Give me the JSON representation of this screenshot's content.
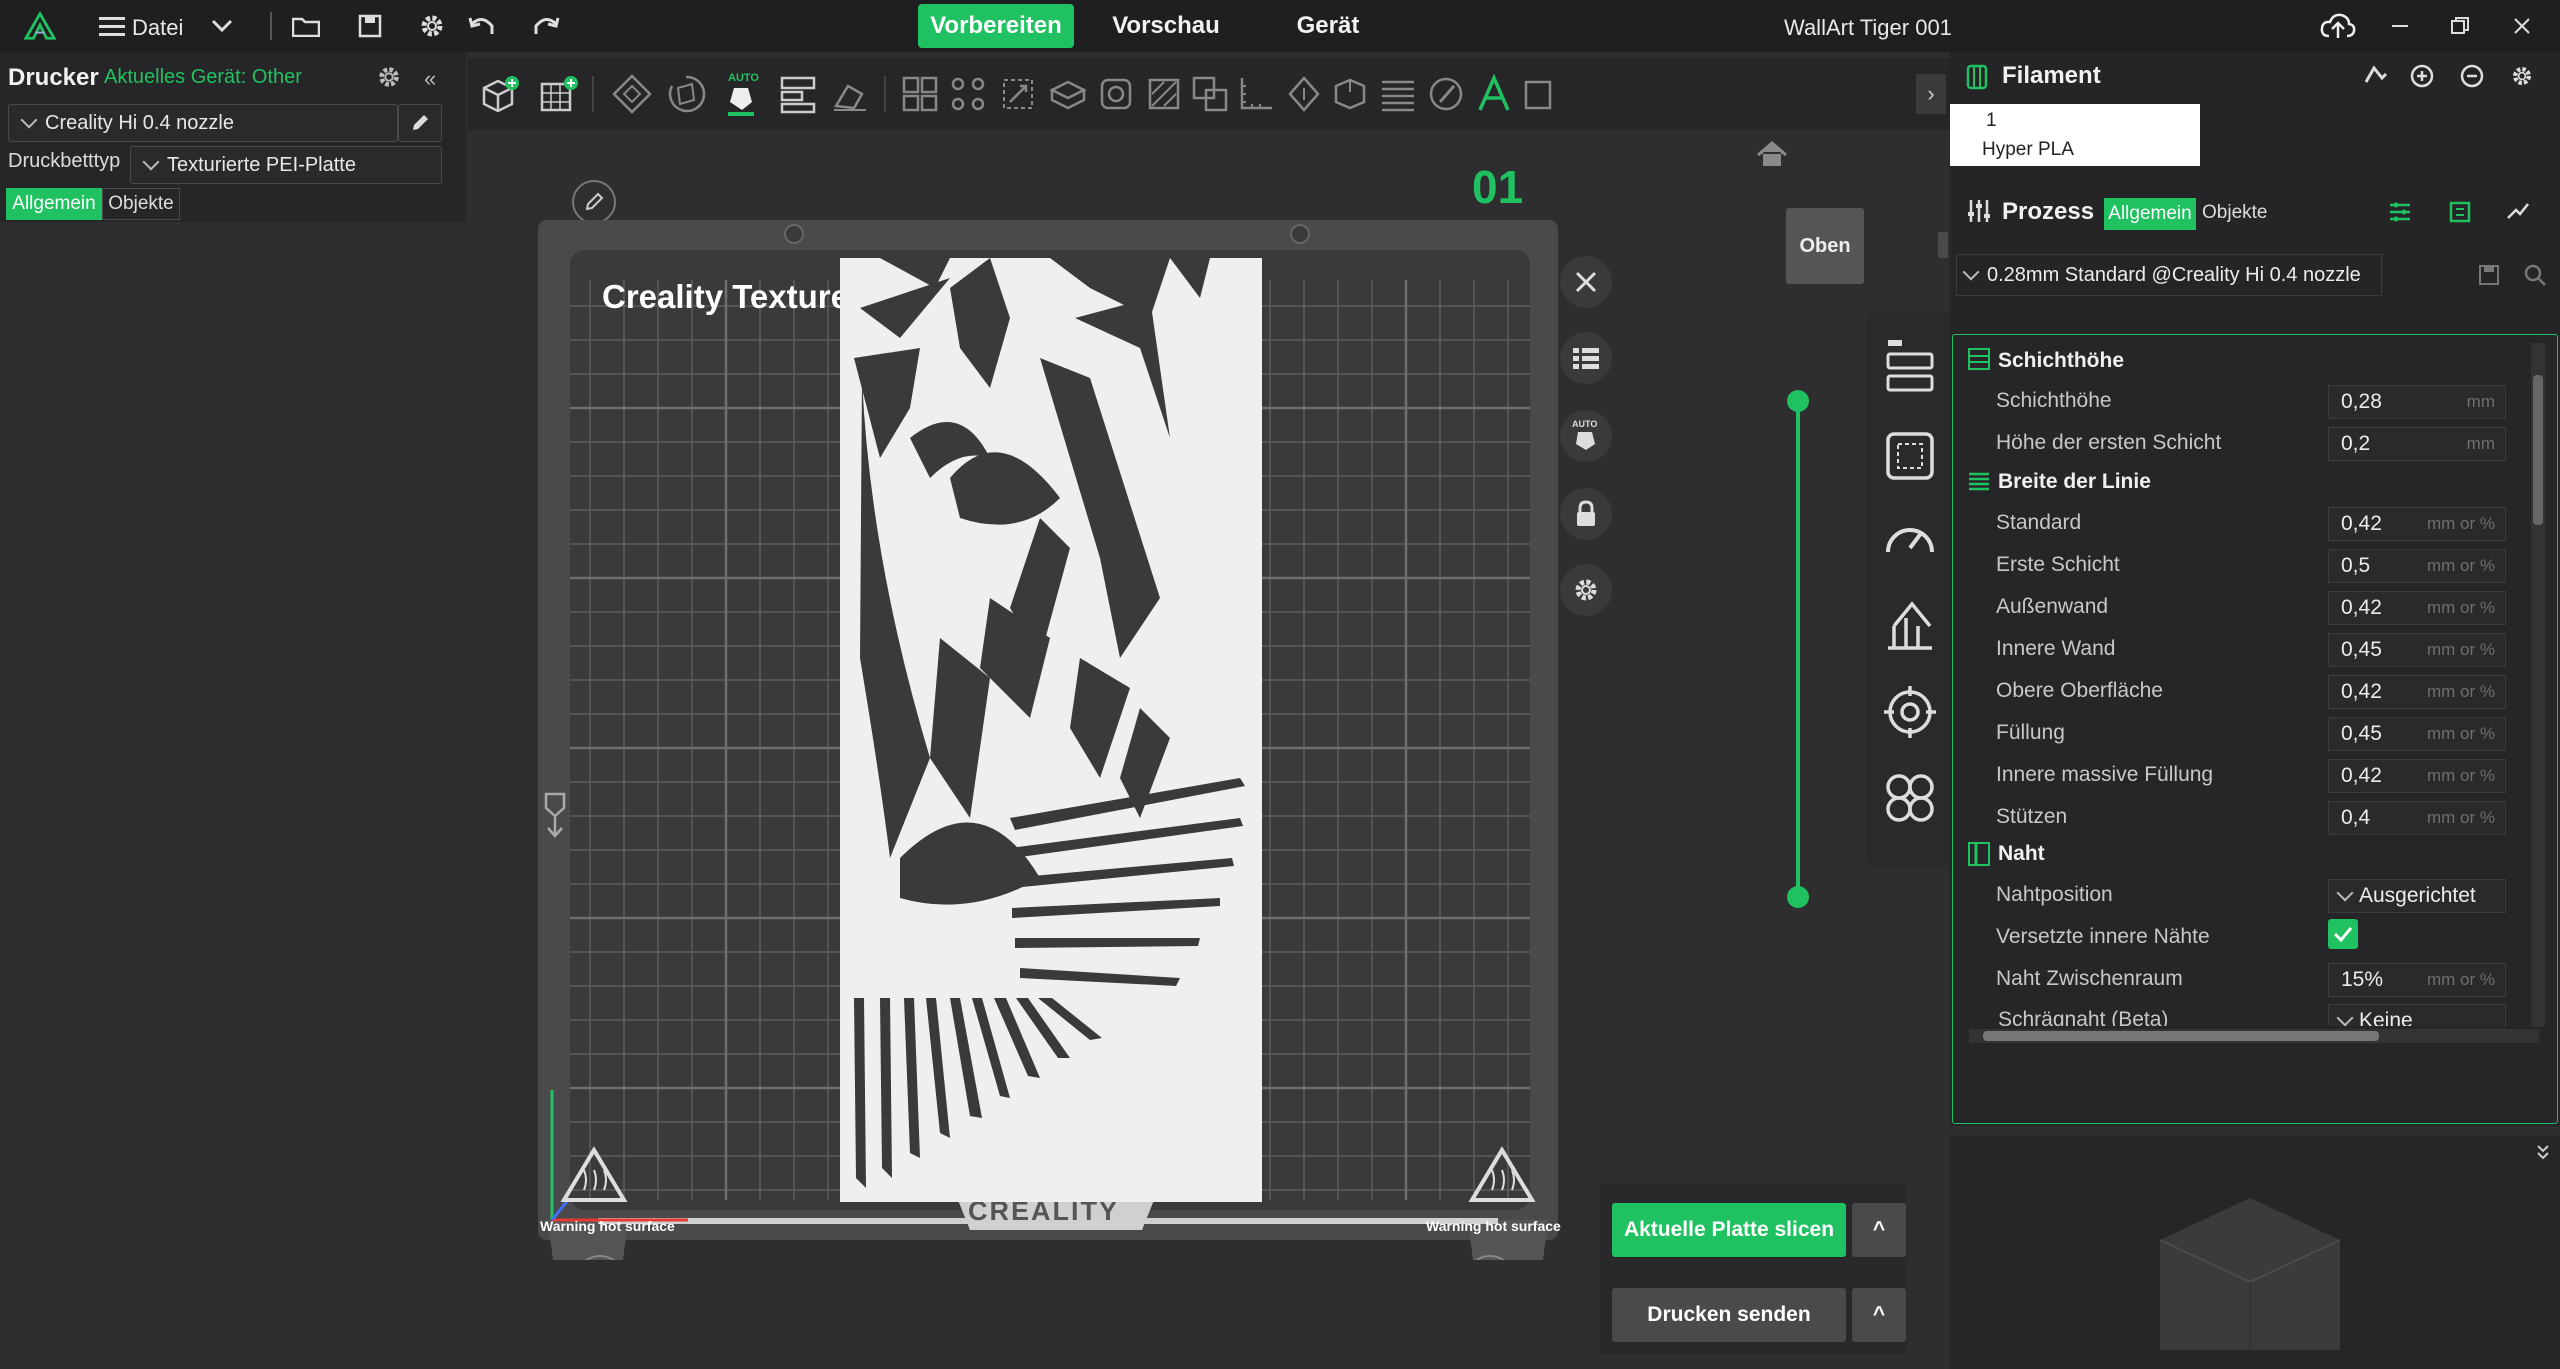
{
  "app": {
    "logo": "creality-logo",
    "menu_label": "Datei",
    "window_title": "WallArt Tiger 001"
  },
  "tabs": [
    {
      "label": "Vorbereiten",
      "active": true
    },
    {
      "label": "Vorschau",
      "active": false
    },
    {
      "label": "Gerät",
      "active": false
    }
  ],
  "left_panel": {
    "title": "Drucker",
    "current_device": "Aktuelles Gerät: Other",
    "printer": "Creality Hi 0.4 nozzle",
    "bed_type_label": "Druckbetttyp",
    "bed_type_value": "Texturierte PEI-Platte",
    "seg_general": "Allgemein",
    "seg_objects": "Objekte"
  },
  "plate": {
    "number": "01",
    "label": "Creality Textured PEI Plate",
    "brand": "CREALITY",
    "warning_left": "Warning hot surface",
    "warning_right": "Warning hot surface"
  },
  "view": {
    "top_button": "Oben"
  },
  "actions": {
    "slice": "Aktuelle Platte slicen",
    "send": "Drucken senden",
    "caret": "^"
  },
  "filament": {
    "title": "Filament",
    "slot_number": "1",
    "slot_name": "Hyper PLA"
  },
  "process": {
    "title": "Prozess",
    "seg_general": "Allgemein",
    "seg_objects": "Objekte",
    "preset": "0.28mm Standard @Creality Hi 0.4 nozzle",
    "sections": {
      "layer_height": "Schichthöhe",
      "line_width": "Breite der Linie",
      "seam": "Naht"
    },
    "layer_rows": [
      {
        "label": "Schichthöhe",
        "value": "0,28",
        "unit": "mm"
      },
      {
        "label": "Höhe der ersten Schicht",
        "value": "0,2",
        "unit": "mm"
      }
    ],
    "width_rows": [
      {
        "label": "Standard",
        "value": "0,42",
        "unit": "mm or %"
      },
      {
        "label": "Erste Schicht",
        "value": "0,5",
        "unit": "mm or %"
      },
      {
        "label": "Außenwand",
        "value": "0,42",
        "unit": "mm or %"
      },
      {
        "label": "Innere Wand",
        "value": "0,45",
        "unit": "mm or %"
      },
      {
        "label": "Obere Oberfläche",
        "value": "0,42",
        "unit": "mm or %"
      },
      {
        "label": "Füllung",
        "value": "0,45",
        "unit": "mm or %"
      },
      {
        "label": "Innere massive Füllung",
        "value": "0,42",
        "unit": "mm or %"
      },
      {
        "label": "Stützen",
        "value": "0,4",
        "unit": "mm or %"
      }
    ],
    "seam_rows": {
      "position_label": "Nahtposition",
      "position_value": "Ausgerichtet",
      "staggered_label": "Versetzte innere Nähte",
      "staggered_checked": true,
      "gap_label": "Naht Zwischenraum",
      "gap_value": "15%",
      "gap_unit": "mm or %",
      "scarf_label": "Schrägnaht (Beta)",
      "scarf_value": "Keine"
    }
  },
  "colors": {
    "accent": "#1fc160",
    "background": "#2e2e30",
    "panel": "#252527"
  }
}
